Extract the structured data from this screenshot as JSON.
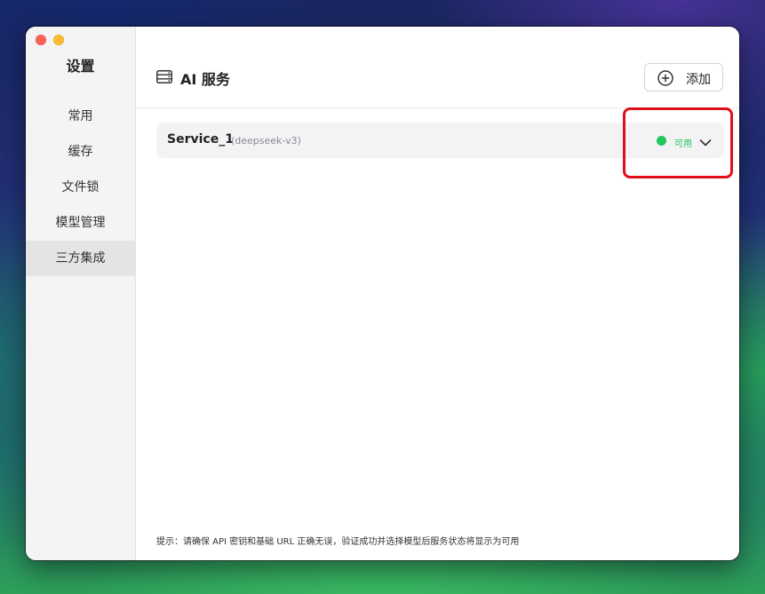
{
  "window": {
    "sidebar_title": "设置",
    "nav_items": [
      {
        "label": "常用",
        "active": false
      },
      {
        "label": "缓存",
        "active": false
      },
      {
        "label": "文件锁",
        "active": false
      },
      {
        "label": "模型管理",
        "active": false
      },
      {
        "label": "三方集成",
        "active": true
      }
    ]
  },
  "header": {
    "icon": "server-icon",
    "title": "AI 服务",
    "add_icon": "plus-circle-icon",
    "add_label": "添加"
  },
  "services": [
    {
      "name": "Service_1",
      "model": "(deepseek-v3)",
      "status_label": "可用",
      "status_color": "#22c55e",
      "expand_icon": "chevron-down-icon"
    }
  ],
  "footer_hint": "提示：请确保 API 密钥和基础 URL 正确无误，验证成功并选择模型后服务状态将显示为可用",
  "colors": {
    "annotation_highlight": "#e0101a",
    "accent_green": "#22c55e"
  }
}
